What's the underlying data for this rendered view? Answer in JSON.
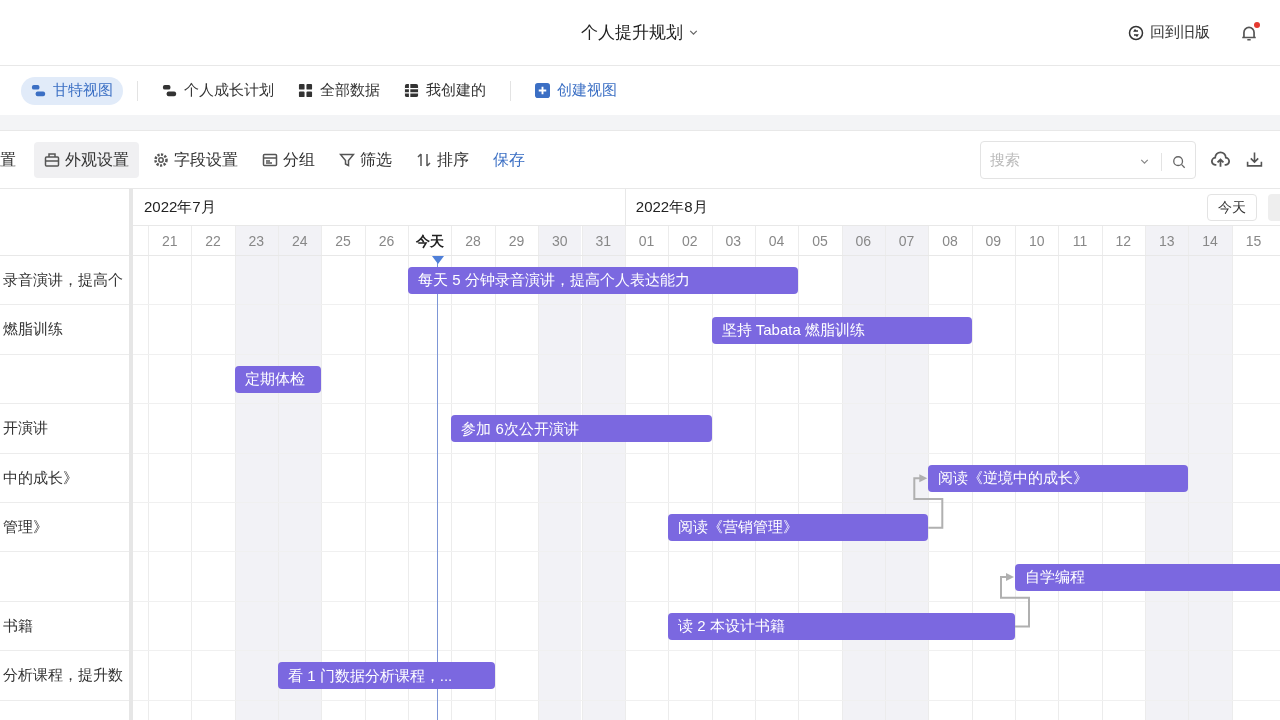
{
  "header": {
    "title": "个人提升规划",
    "old_version": "回到旧版",
    "notification": true
  },
  "views": [
    {
      "label": "甘特视图",
      "kind": "view",
      "selected": true
    },
    {
      "label": "个人成长计划",
      "kind": "view",
      "selected": false
    },
    {
      "label": "全部数据",
      "kind": "view",
      "selected": false
    },
    {
      "label": "我创建的",
      "kind": "view",
      "selected": false
    },
    {
      "label": "创建视图",
      "kind": "create",
      "selected": false
    }
  ],
  "toolbar": [
    {
      "label": "置",
      "kind": "tool",
      "selected": false
    },
    {
      "label": "外观设置",
      "kind": "tool",
      "selected": true
    },
    {
      "label": "字段设置",
      "kind": "tool",
      "selected": false
    },
    {
      "label": "分组",
      "kind": "tool",
      "selected": false
    },
    {
      "label": "筛选",
      "kind": "tool",
      "selected": false
    },
    {
      "label": "排序",
      "kind": "tool",
      "selected": false
    },
    {
      "label": "保存",
      "kind": "link",
      "selected": false
    }
  ],
  "search": {
    "placeholder": "搜索"
  },
  "timeline": {
    "today_button": "今天",
    "months": [
      {
        "label": "2022年7月"
      },
      {
        "label": "2022年8月"
      }
    ],
    "days": [
      {
        "label": "21",
        "weekend": false,
        "today": false
      },
      {
        "label": "22",
        "weekend": false,
        "today": false
      },
      {
        "label": "23",
        "weekend": true,
        "today": false
      },
      {
        "label": "24",
        "weekend": true,
        "today": false
      },
      {
        "label": "25",
        "weekend": false,
        "today": false
      },
      {
        "label": "26",
        "weekend": false,
        "today": false
      },
      {
        "label": "今天",
        "weekend": false,
        "today": true
      },
      {
        "label": "28",
        "weekend": false,
        "today": false
      },
      {
        "label": "29",
        "weekend": false,
        "today": false
      },
      {
        "label": "30",
        "weekend": true,
        "today": false
      },
      {
        "label": "31",
        "weekend": true,
        "today": false
      },
      {
        "label": "01",
        "weekend": false,
        "today": false
      },
      {
        "label": "02",
        "weekend": false,
        "today": false
      },
      {
        "label": "03",
        "weekend": false,
        "today": false
      },
      {
        "label": "04",
        "weekend": false,
        "today": false
      },
      {
        "label": "05",
        "weekend": false,
        "today": false
      },
      {
        "label": "06",
        "weekend": true,
        "today": false
      },
      {
        "label": "07",
        "weekend": true,
        "today": false
      },
      {
        "label": "08",
        "weekend": false,
        "today": false
      },
      {
        "label": "09",
        "weekend": false,
        "today": false
      },
      {
        "label": "10",
        "weekend": false,
        "today": false
      },
      {
        "label": "11",
        "weekend": false,
        "today": false
      },
      {
        "label": "12",
        "weekend": false,
        "today": false
      },
      {
        "label": "13",
        "weekend": true,
        "today": false
      },
      {
        "label": "14",
        "weekend": true,
        "today": false
      },
      {
        "label": "15",
        "weekend": false,
        "today": false
      }
    ]
  },
  "rows": [
    {
      "title": "录音演讲，提高个",
      "bar": {
        "label": "每天 5 分钟录音演讲，提高个人表达能力"
      }
    },
    {
      "title": "燃脂训练",
      "bar": {
        "label": "坚持 Tabata 燃脂训练"
      }
    },
    {
      "bar": {
        "label": "定期体检"
      }
    },
    {
      "title": "开演讲",
      "bar": {
        "label": "参加 6次公开演讲"
      }
    },
    {
      "title": "中的成长》",
      "bar": {
        "label": "阅读《逆境中的成长》"
      }
    },
    {
      "title": "管理》",
      "bar": {
        "label": "阅读《营销管理》"
      }
    },
    {
      "bar": {
        "label": "自学编程"
      }
    },
    {
      "title": "书籍",
      "bar": {
        "label": "读 2 本设计书籍"
      }
    },
    {
      "title": "分析课程，提升数",
      "bar": {
        "label": "看 1 门数据分析课程，..."
      }
    }
  ]
}
